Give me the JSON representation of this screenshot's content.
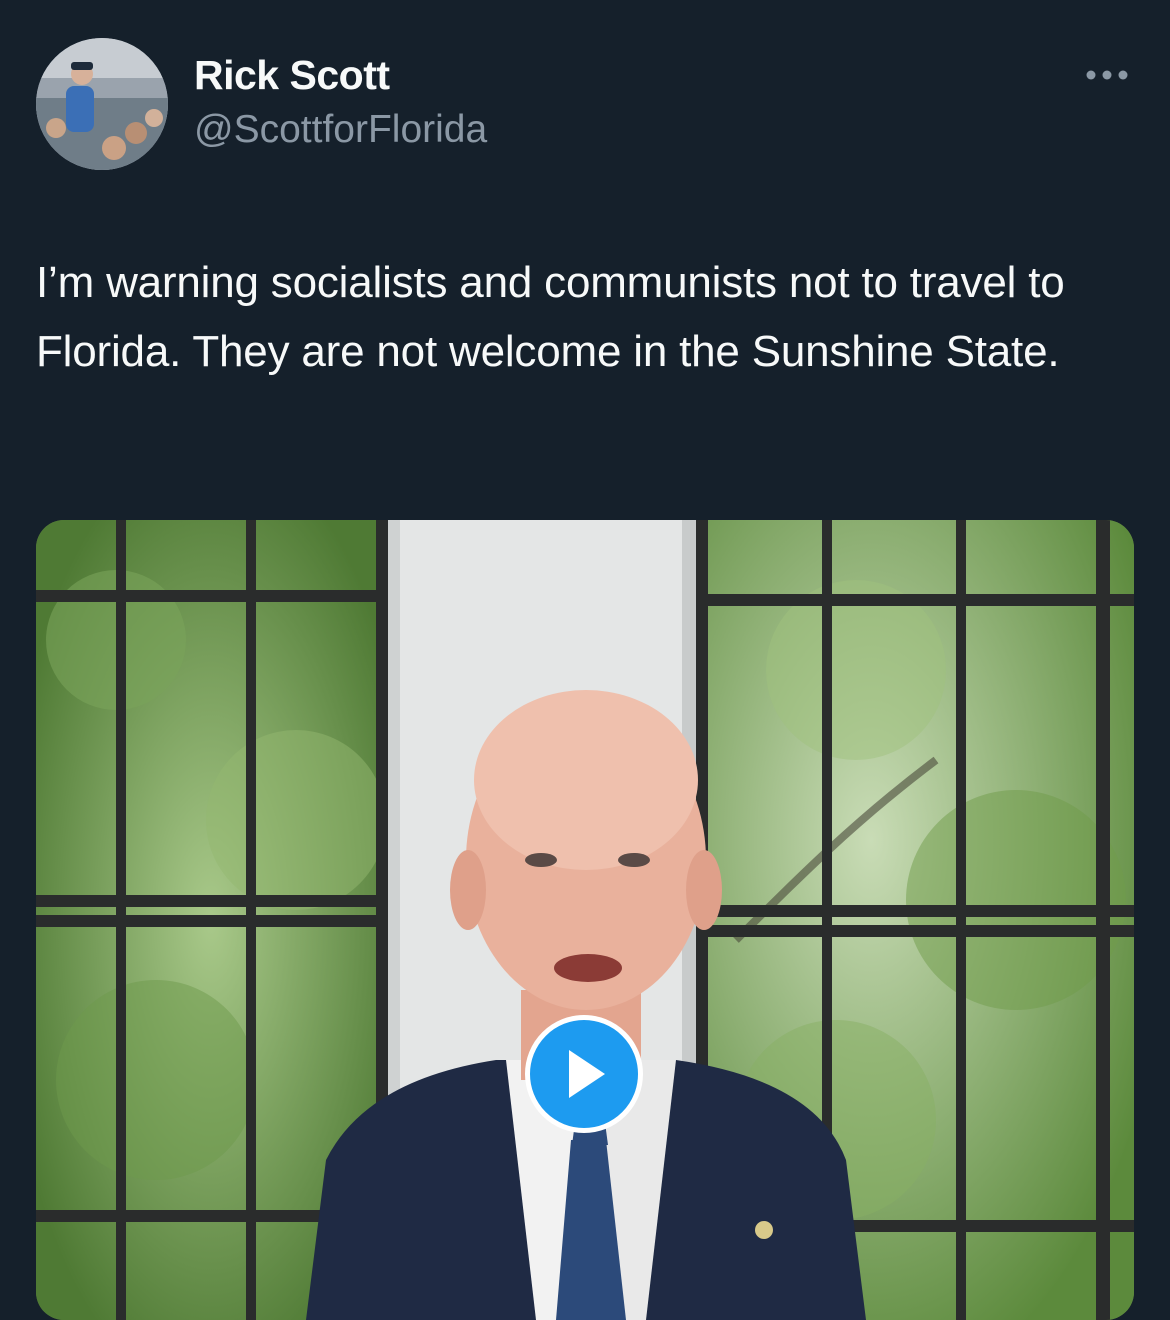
{
  "author": {
    "name": "Rick Scott",
    "handle": "@ScottforFlorida",
    "avatar_icon": "profile-photo"
  },
  "header": {
    "more_icon": "more-horizontal-icon"
  },
  "tweet": {
    "text": "I’m warning socialists and communists not to travel to Florida. They are not welcome in the Sunshine State."
  },
  "media": {
    "type": "video",
    "play_icon": "play-icon",
    "accent_color": "#1d9bf0"
  },
  "colors": {
    "background": "#15202b",
    "primary_text": "#f7f9f9",
    "secondary_text": "#8b98a5"
  }
}
